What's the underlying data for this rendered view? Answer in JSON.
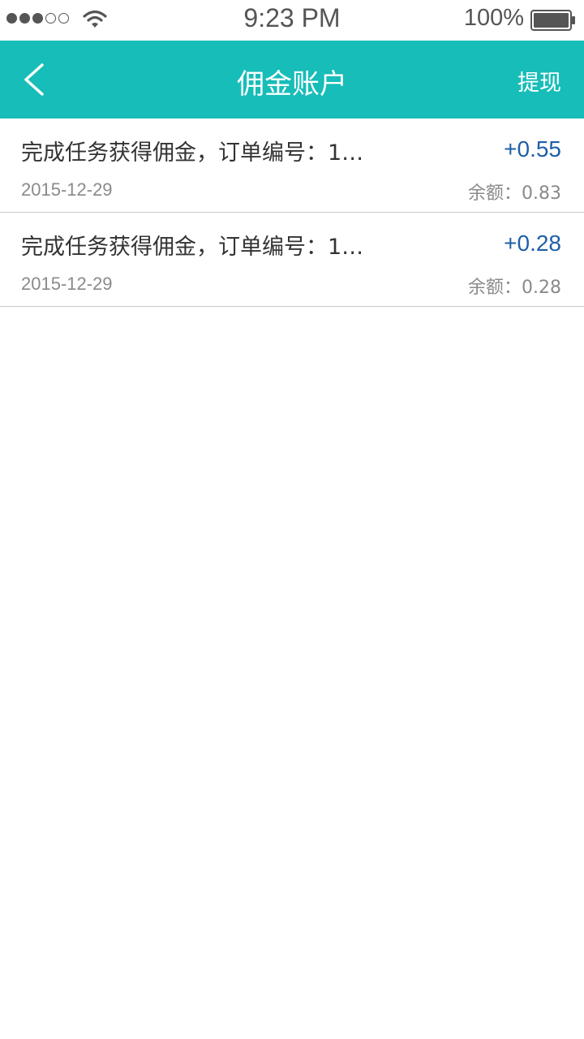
{
  "status_bar": {
    "signal_dots": [
      true,
      true,
      true,
      false,
      false
    ],
    "signal_icon": "signal-dots-icon",
    "wifi_icon": "wifi-icon",
    "time": "9:23 PM",
    "battery_percent": "100%",
    "battery_icon": "battery-full-icon"
  },
  "nav": {
    "back_icon": "chevron-left-icon",
    "title": "佣金账户",
    "withdraw_label": "提现",
    "bar_color": "#17bdb8"
  },
  "records": [
    {
      "description": "完成任务获得佣金，订单编号：1…",
      "amount": "+0.55",
      "date": "2015-12-29",
      "balance": "余额：0.83"
    },
    {
      "description": "完成任务获得佣金，订单编号：1…",
      "amount": "+0.28",
      "date": "2015-12-29",
      "balance": "余额：0.28"
    }
  ],
  "colors": {
    "amount": "#1f5fa8",
    "secondary_text": "#8a8a8a",
    "primary_text": "#333333"
  }
}
